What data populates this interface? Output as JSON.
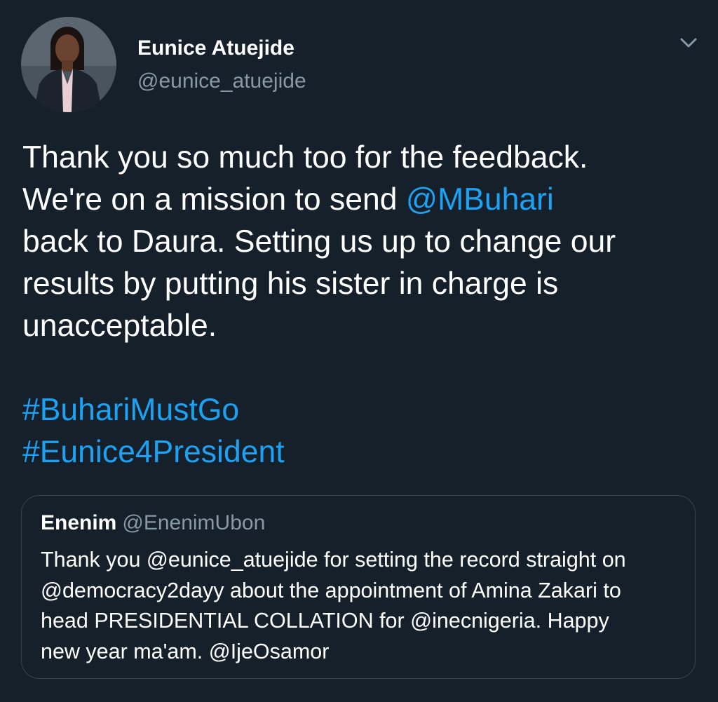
{
  "author": {
    "display_name": "Eunice Atuejide",
    "handle": "@eunice_atuejide",
    "avatar_icon": "profile-photo"
  },
  "menu": {
    "icon": "chevron-down-icon"
  },
  "tweet": {
    "lines": [
      {
        "text": "Thank you so much too for the feedback."
      },
      {
        "before": "We're on a mission to send ",
        "mention": "@MBuhari"
      },
      {
        "text": "back to Daura. Setting us up to change our"
      },
      {
        "text": "results by putting his sister in charge is"
      },
      {
        "text": "unacceptable."
      }
    ],
    "hashtags": [
      "#BuhariMustGo",
      "#Eunice4President"
    ]
  },
  "quote": {
    "name": "Enenim",
    "handle": "@EnenimUbon",
    "lines": [
      "Thank you @eunice_atuejide for setting the record straight on",
      "@democracy2dayy about the appointment of Amina Zakari to",
      "head PRESIDENTIAL COLLATION for @inecnigeria. Happy",
      "new year ma'am. @IjeOsamor"
    ]
  },
  "colors": {
    "background": "#15202b",
    "text_primary": "#ffffff",
    "text_secondary": "#8899a6",
    "link": "#1da1f2",
    "border": "#38444d"
  }
}
